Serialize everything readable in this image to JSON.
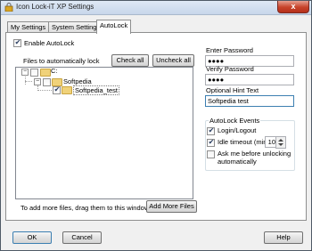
{
  "window": {
    "title": "Icon Lock-iT XP Settings",
    "close_label": "x"
  },
  "tabs": [
    "My Settings",
    "System Settings",
    "AutoLock"
  ],
  "autolock": {
    "enable_label": "Enable AutoLock",
    "files_label": "Files to automatically lock",
    "check_all": "Check all",
    "uncheck_all": "Uncheck all",
    "tree": [
      {
        "label": "C:",
        "level": 0
      },
      {
        "label": "Softpedia",
        "level": 1
      },
      {
        "label": "Softpedia_test",
        "level": 2,
        "checked": true
      }
    ],
    "drag_hint": "To add more files, drag them to this window.",
    "add_more_files": "Add More Files"
  },
  "password": {
    "enter_label": "Enter Password",
    "enter_value": "●●●●",
    "verify_label": "Verify Password",
    "verify_value": "●●●●",
    "hint_label": "Optional Hint Text",
    "hint_value": "Softpedia test"
  },
  "events": {
    "group_label": "AutoLock Events",
    "login_logout": "Login/Logout",
    "idle_timeout": "Idle timeout (min):",
    "idle_value": "10",
    "ask_me": "Ask me before unlocking automatically"
  },
  "footer": {
    "ok": "OK",
    "cancel": "Cancel",
    "help": "Help"
  },
  "colors": {
    "accent": "#3c7fb1",
    "folder": "#f0d27a"
  }
}
